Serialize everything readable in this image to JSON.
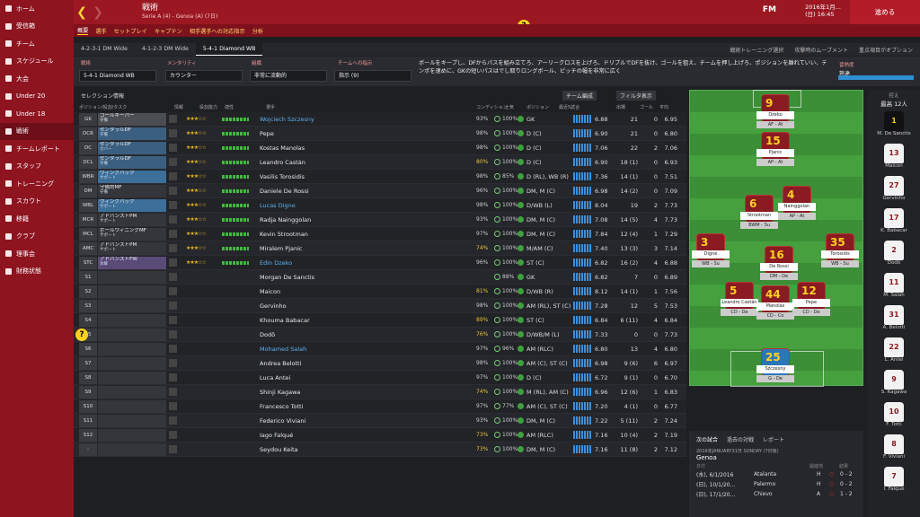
{
  "sidebar": {
    "items": [
      {
        "label": "ホーム"
      },
      {
        "label": "受信箱"
      },
      {
        "label": "チーム"
      },
      {
        "label": "スケジュール"
      },
      {
        "label": "大会"
      },
      {
        "label": "Under 20"
      },
      {
        "label": "Under 18"
      },
      {
        "label": "戦術"
      },
      {
        "label": "チームレポート"
      },
      {
        "label": "スタッフ"
      },
      {
        "label": "トレーニング"
      },
      {
        "label": "スカウト"
      },
      {
        "label": "移籍"
      },
      {
        "label": "クラブ"
      },
      {
        "label": "理事会"
      },
      {
        "label": "財務状態"
      }
    ]
  },
  "header": {
    "title": "戦術",
    "subtitle": "Serie A (4) - Genoa (A) (7日)",
    "date_line1": "2016年1月...",
    "date_line2": "(日) 16:45",
    "continue": "進める",
    "fm": "FM"
  },
  "submenu": [
    "概要",
    "選手",
    "セットプレイ",
    "キャプテン",
    "相手選手への対応指示",
    "分析"
  ],
  "tabs": [
    "4-2-3-1 DM Wide",
    "4-1-2-3 DM Wide",
    "5-4-1 Diamond WB"
  ],
  "tab_right": [
    "戦術トレーニング選択",
    "攻撃時のムーブメント",
    "重点項目がオプション"
  ],
  "controls": {
    "formation_label": "戦術",
    "formation": "5-4-1 Diamond WB",
    "mentality_label": "メンタリティ",
    "mentality": "カウンター",
    "shape_label": "組織",
    "shape": "非常に流動的",
    "instr_label": "チームへの指示",
    "instr": "指示 (9)",
    "fam_label": "習熟度",
    "fam_value": "熟達"
  },
  "description": "ボールをキープし、DFからパスを組み立てろ、アーリークロスを上げろ、ドリブルでDFを抜け、ゴールを狙え、チームを押し上げろ、ポジションを離れていい、テンポを速めに、GKの短いパスはでし取りロングボール、ピッチの幅を非常に広く",
  "table": {
    "sel_info": "セレクション情報",
    "team_form": "チーム編成",
    "filter": "フィルタ表示",
    "headers": [
      "ポジション/役割/タスク",
      "情報",
      "役割能力",
      "適性",
      "選手",
      "コンディション",
      "士気",
      "ポジション",
      "最近5試合",
      "出場",
      "ゴール",
      "平均"
    ],
    "rows": [
      {
        "pos": "GK",
        "role": "ゴールキーパー",
        "task": "守備",
        "rc": "roleG",
        "tag": "",
        "stars": "★★★☆☆",
        "name": "Wojciech Szczesny",
        "blue": true,
        "pct": "93%",
        "cond": "100%",
        "ppos": "GK",
        "rat": "6.88",
        "c1": "21",
        "c2": "0",
        "c3": "6.95"
      },
      {
        "pos": "DCR",
        "role": "センタラルDF",
        "task": "守備",
        "rc": "roleT",
        "tag": "",
        "stars": "★★★☆☆",
        "name": "Pepe",
        "blue": false,
        "pct": "98%",
        "cond": "100%",
        "ppos": "D (C)",
        "rat": "6.90",
        "c1": "21",
        "c2": "0",
        "c3": "6.80"
      },
      {
        "pos": "DC",
        "role": "センタラルDF",
        "task": "カバー",
        "rc": "roleT",
        "tag": "",
        "stars": "★★★☆☆",
        "name": "Kostas Manolas",
        "blue": false,
        "pct": "98%",
        "cond": "100%",
        "ppos": "D (C)",
        "rat": "7.06",
        "c1": "22",
        "c2": "2",
        "c3": "7.06"
      },
      {
        "pos": "DCL",
        "role": "センタラルDF",
        "task": "守備",
        "rc": "roleT",
        "tag": "",
        "stars": "★★★☆☆",
        "name": "Leandro Castán",
        "blue": false,
        "pct": "80%",
        "cond": "100%",
        "ppos": "D (C)",
        "rat": "6.90",
        "c1": "18 (1)",
        "c2": "0",
        "c3": "6.93"
      },
      {
        "pos": "WBR",
        "role": "ウィングバック",
        "task": "サポート",
        "rc": "roleB",
        "tag": "",
        "stars": "★★★☆☆",
        "name": "Vasilis Torosidis",
        "blue": false,
        "pct": "98%",
        "cond": "85%",
        "ppos": "D (RL), WB (R)",
        "rat": "7.36",
        "c1": "14 (1)",
        "c2": "0",
        "c3": "7.51"
      },
      {
        "pos": "DM",
        "role": "守備的MF",
        "task": "守備",
        "rc": "roleE",
        "tag": "",
        "stars": "★★★☆☆",
        "name": "Daniele De Rossi",
        "blue": false,
        "pct": "96%",
        "cond": "100%",
        "ppos": "DM, M (C)",
        "rat": "6.98",
        "c1": "14 (2)",
        "c2": "0",
        "c3": "7.09"
      },
      {
        "pos": "WBL",
        "role": "ウィングバック",
        "task": "サポート",
        "rc": "roleB",
        "tag": "",
        "stars": "★★★☆☆",
        "name": "Lucas Digne",
        "blue": true,
        "pct": "98%",
        "cond": "100%",
        "ppos": "D/WB (L)",
        "rat": "8.04",
        "c1": "19",
        "c2": "2",
        "c3": "7.73"
      },
      {
        "pos": "MCR",
        "role": "アドバンストPM",
        "task": "サポート",
        "rc": "roleE",
        "tag": "",
        "stars": "★★★☆☆",
        "name": "Radja Nainggolan",
        "blue": false,
        "pct": "93%",
        "cond": "100%",
        "ppos": "DM, M (C)",
        "rat": "7.08",
        "c1": "14 (5)",
        "c2": "4",
        "c3": "7.73"
      },
      {
        "pos": "MCL",
        "role": "ボールウィニングMF",
        "task": "サポート",
        "rc": "roleE",
        "tag": "",
        "stars": "★★★☆☆",
        "name": "Kevin Strootman",
        "blue": false,
        "pct": "97%",
        "cond": "100%",
        "ppos": "DM, M (C)",
        "rat": "7.84",
        "c1": "12 (4)",
        "c2": "1",
        "c3": "7.29"
      },
      {
        "pos": "AMC",
        "role": "アドバンストPM",
        "task": "サポート",
        "rc": "roleE",
        "tag": "",
        "stars": "★★★☆☆",
        "name": "Miralem Pjanic",
        "blue": false,
        "pct": "74%",
        "cond": "100%",
        "ppos": "M/AM (C)",
        "rat": "7.40",
        "c1": "13 (3)",
        "c2": "3",
        "c3": "7.14"
      },
      {
        "pos": "STC",
        "role": "アドバンストFW",
        "task": "攻撃",
        "rc": "roleP",
        "tag": "",
        "stars": "★★★☆☆",
        "name": "Edin Dzeko",
        "blue": true,
        "pct": "96%",
        "cond": "100%",
        "ppos": "ST (C)",
        "rat": "6.82",
        "c1": "16 (2)",
        "c2": "4",
        "c3": "6.88"
      },
      {
        "pos": "S1",
        "role": "",
        "task": "",
        "rc": "roleE",
        "tag": "",
        "stars": "",
        "name": "Morgan De Sanctis",
        "blue": false,
        "pct": "",
        "cond": "88%",
        "ppos": "GK",
        "rat": "6.82",
        "c1": "7",
        "c2": "0",
        "c3": "6.89"
      },
      {
        "pos": "S2",
        "role": "",
        "task": "",
        "rc": "roleE",
        "tag": "",
        "stars": "",
        "name": "Maicon",
        "blue": false,
        "pct": "81%",
        "cond": "100%",
        "ppos": "D/WB (R)",
        "rat": "8.12",
        "c1": "14 (1)",
        "c2": "1",
        "c3": "7.56"
      },
      {
        "pos": "S3",
        "role": "",
        "task": "",
        "rc": "roleE",
        "tag": "",
        "stars": "",
        "name": "Gervinho",
        "blue": false,
        "pct": "98%",
        "cond": "100%",
        "ppos": "AM (RL), ST (C)",
        "rat": "7.28",
        "c1": "12",
        "c2": "5",
        "c3": "7.53"
      },
      {
        "pos": "S4",
        "role": "",
        "task": "",
        "rc": "roleE",
        "tag": "",
        "stars": "",
        "name": "Khouma Babacar",
        "blue": false,
        "pct": "89%",
        "cond": "100%",
        "ppos": "ST (C)",
        "rat": "6.84",
        "c1": "6 (11)",
        "c2": "4",
        "c3": "6.84"
      },
      {
        "pos": "S5",
        "role": "",
        "task": "",
        "rc": "roleE",
        "tag": "",
        "stars": "",
        "name": "Dodô",
        "blue": false,
        "pct": "76%",
        "cond": "100%",
        "ppos": "D/WB/M (L)",
        "rat": "7.33",
        "c1": "0",
        "c2": "0",
        "c3": "7.73"
      },
      {
        "pos": "S6",
        "role": "",
        "task": "",
        "rc": "roleE",
        "tag": "",
        "stars": "",
        "name": "Mohamed Salah",
        "blue": true,
        "pct": "97%",
        "cond": "96%",
        "ppos": "AM (RLC)",
        "rat": "6.80",
        "c1": "13",
        "c2": "4",
        "c3": "6.80"
      },
      {
        "pos": "S7",
        "role": "",
        "task": "",
        "rc": "roleE",
        "tag": "",
        "stars": "",
        "name": "Andrea Belotti",
        "blue": false,
        "pct": "98%",
        "cond": "100%",
        "ppos": "AM (C), ST (C)",
        "rat": "6.98",
        "c1": "9 (6)",
        "c2": "6",
        "c3": "6.97"
      },
      {
        "pos": "S8",
        "role": "",
        "task": "",
        "rc": "roleE",
        "tag": "",
        "stars": "",
        "name": "Luca Antei",
        "blue": false,
        "pct": "97%",
        "cond": "100%",
        "ppos": "D (C)",
        "rat": "6.72",
        "c1": "9 (1)",
        "c2": "0",
        "c3": "6.70"
      },
      {
        "pos": "S9",
        "role": "",
        "task": "",
        "rc": "roleE",
        "tag": "",
        "stars": "",
        "name": "Shinji Kagawa",
        "blue": false,
        "pct": "74%",
        "cond": "100%",
        "ppos": "M (RL), AM (C)",
        "rat": "6.96",
        "c1": "12 (6)",
        "c2": "1",
        "c3": "6.83"
      },
      {
        "pos": "S10",
        "role": "",
        "task": "",
        "rc": "roleE",
        "tag": "",
        "stars": "",
        "name": "Francesco Totti",
        "blue": false,
        "pct": "97%",
        "cond": "77%",
        "ppos": "AM (C), ST (C)",
        "rat": "7.20",
        "c1": "4 (1)",
        "c2": "0",
        "c3": "6.77"
      },
      {
        "pos": "S11",
        "role": "",
        "task": "",
        "rc": "roleE",
        "tag": "",
        "stars": "",
        "name": "Federico Viviani",
        "blue": false,
        "pct": "93%",
        "cond": "100%",
        "ppos": "DM, M (C)",
        "rat": "7.22",
        "c1": "5 (11)",
        "c2": "2",
        "c3": "7.24"
      },
      {
        "pos": "S12",
        "role": "",
        "task": "",
        "rc": "roleE",
        "tag": "",
        "stars": "",
        "name": "Iago Falqué",
        "blue": false,
        "pct": "73%",
        "cond": "100%",
        "ppos": "AM (RLC)",
        "rat": "7.16",
        "c1": "10 (4)",
        "c2": "2",
        "c3": "7.19"
      },
      {
        "pos": "-",
        "role": "",
        "task": "",
        "rc": "roleE",
        "tag": "",
        "stars": "",
        "name": "Seydou Keita",
        "blue": false,
        "pct": "73%",
        "cond": "100%",
        "ppos": "DM, M (C)",
        "rat": "7.16",
        "c1": "11 (8)",
        "c2": "2",
        "c3": "7.12"
      }
    ]
  },
  "pitch": [
    {
      "num": "9",
      "name": "Dzeko",
      "role": "AF - At",
      "gk": false
    },
    {
      "num": "15",
      "name": "Pjanic",
      "role": "AP - At",
      "gk": false
    },
    {
      "num": "4",
      "name": "Nainggolan",
      "role": "AP - At",
      "gk": false
    },
    {
      "num": "6",
      "name": "Strootman",
      "role": "BWM - Su",
      "gk": false
    },
    {
      "num": "3",
      "name": "Digne",
      "role": "WB - Su",
      "gk": false
    },
    {
      "num": "16",
      "name": "De Rossi",
      "role": "DM - De",
      "gk": false
    },
    {
      "num": "35",
      "name": "Torosidis",
      "role": "WB - Su",
      "gk": false
    },
    {
      "num": "5",
      "name": "Leandro Castán",
      "role": "CD - De",
      "gk": false
    },
    {
      "num": "44",
      "name": "Manolas",
      "role": "CD - Co",
      "gk": false
    },
    {
      "num": "12",
      "name": "Pepe",
      "role": "CD - De",
      "gk": false
    },
    {
      "num": "25",
      "name": "Szczesny",
      "role": "G - De",
      "gk": true
    }
  ],
  "subs": {
    "title": "控え",
    "count": "最高 12人",
    "players": [
      {
        "num": "1",
        "name": "M. De Sanctis",
        "gk": true
      },
      {
        "num": "13",
        "name": "Maicon",
        "gk": false
      },
      {
        "num": "27",
        "name": "Gervinho",
        "gk": false
      },
      {
        "num": "17",
        "name": "K. Babacar",
        "gk": false
      },
      {
        "num": "2",
        "name": "Dodô",
        "gk": false
      },
      {
        "num": "11",
        "name": "M. Salah",
        "gk": false
      },
      {
        "num": "31",
        "name": "A. Belotti",
        "gk": false
      },
      {
        "num": "22",
        "name": "L. Antei",
        "gk": false
      },
      {
        "num": "9",
        "name": "S. Kagawa",
        "gk": false
      },
      {
        "num": "10",
        "name": "F. Totti",
        "gk": false
      },
      {
        "num": "8",
        "name": "F. Viviani",
        "gk": false
      },
      {
        "num": "7",
        "name": "I. Falqué",
        "gk": false
      }
    ]
  },
  "fixtures": {
    "tabs": [
      "次の試合",
      "過去の対戦",
      "レポート"
    ],
    "next_date": "2016年JANUARY31日 SUNDAY (7日後)",
    "next_team": "Genoa",
    "col_date": "日付",
    "col_ha": "開催地",
    "col_res": "結果",
    "rows": [
      {
        "date": "(水), 6/1/2016",
        "team": "Atalanta",
        "ha": "H",
        "res": "0 - 2"
      },
      {
        "date": "(日), 10/1/20...",
        "team": "Palermo",
        "ha": "H",
        "res": "0 - 2"
      },
      {
        "date": "(日), 17/1/20...",
        "team": "Chievo",
        "ha": "A",
        "res": "1 - 2"
      }
    ]
  }
}
